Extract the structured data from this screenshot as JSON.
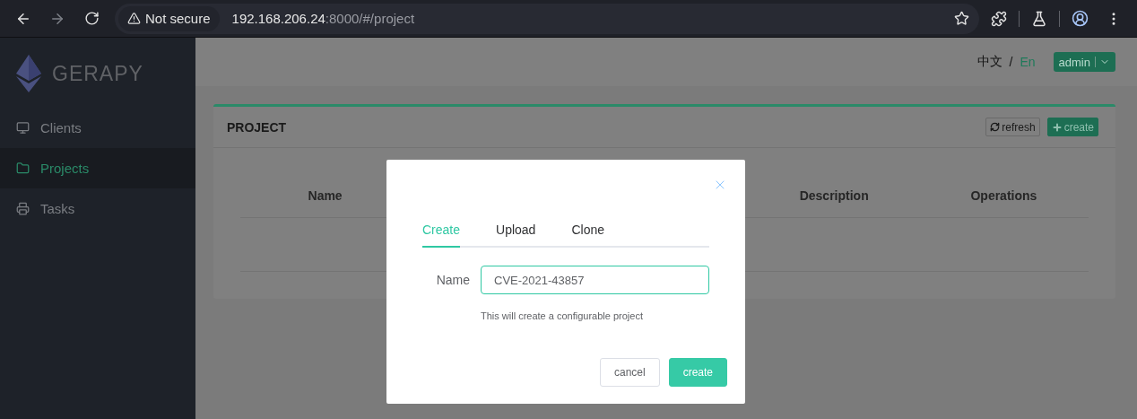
{
  "browser": {
    "forward": {
      "disabled": true
    },
    "security_label": "Not secure",
    "url_host": "192.168.206.24",
    "url_rest": ":8000/#/project"
  },
  "sidebar": {
    "logo": "GERAPY",
    "items": [
      {
        "label": "Clients",
        "selected": false
      },
      {
        "label": "Projects",
        "selected": true
      },
      {
        "label": "Tasks",
        "selected": false
      }
    ]
  },
  "header": {
    "languages": [
      {
        "label": "中文",
        "selected": false
      },
      {
        "label": "En",
        "selected": true
      }
    ],
    "separator": "/",
    "user": "admin"
  },
  "card": {
    "title": "PROJECT",
    "refresh": "refresh",
    "create": "create",
    "table": {
      "columns": [
        "Name",
        "Description",
        "Operations"
      ]
    }
  },
  "dialog": {
    "tabs": [
      {
        "label": "Create",
        "selected": true
      },
      {
        "label": "Upload",
        "selected": false
      },
      {
        "label": "Clone",
        "selected": false
      }
    ],
    "field_label": "Name",
    "field_value": "CVE-2021-43857",
    "hint": "This will create a configurable project",
    "cancel": "cancel",
    "submit": "create"
  }
}
